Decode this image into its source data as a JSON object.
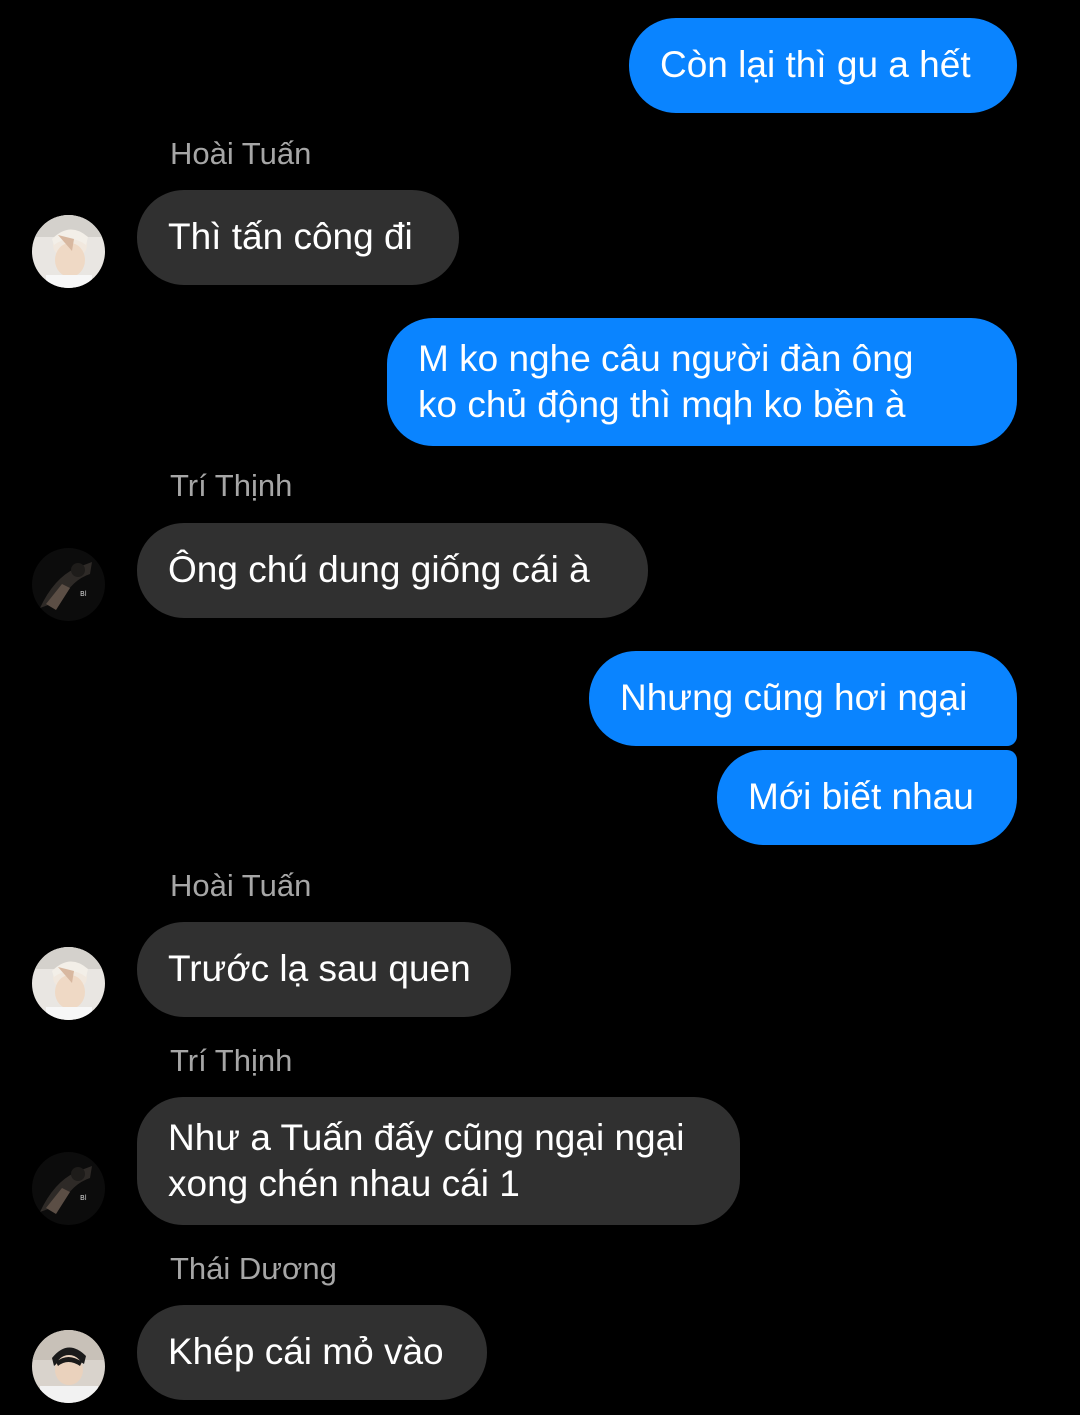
{
  "conversation": {
    "messages": [
      {
        "direction": "outgoing",
        "text": "Còn lại thì gu a hết"
      },
      {
        "direction": "incoming",
        "sender": "Hoài Tuấn",
        "avatar": "hoai-tuan-avatar",
        "text": "Thì tấn công đi"
      },
      {
        "direction": "outgoing",
        "text": "M ko nghe câu người đàn ông\nko chủ động thì mqh ko bền à"
      },
      {
        "direction": "incoming",
        "sender": "Trí Thịnh",
        "avatar": "tri-thinh-avatar",
        "text": "Ông chú dung giống cái à"
      },
      {
        "direction": "outgoing",
        "text": "Nhưng cũng hơi ngại"
      },
      {
        "direction": "outgoing",
        "text": "Mới biết nhau"
      },
      {
        "direction": "incoming",
        "sender": "Hoài Tuấn",
        "avatar": "hoai-tuan-avatar",
        "text": "Trước lạ sau quen"
      },
      {
        "direction": "incoming",
        "sender": "Trí Thịnh",
        "avatar": "tri-thinh-avatar",
        "text": "Như a Tuấn đấy cũng ngại ngại\nxong chén nhau cái 1"
      },
      {
        "direction": "incoming",
        "sender": "Thái Dương",
        "avatar": "thai-duong-avatar",
        "text": "Khép cái mỏ vào"
      }
    ]
  },
  "colors": {
    "background": "#000000",
    "outgoing_bubble": "#0a84ff",
    "incoming_bubble": "#303030",
    "sender_name": "#a6a6a6",
    "text": "#ffffff"
  }
}
